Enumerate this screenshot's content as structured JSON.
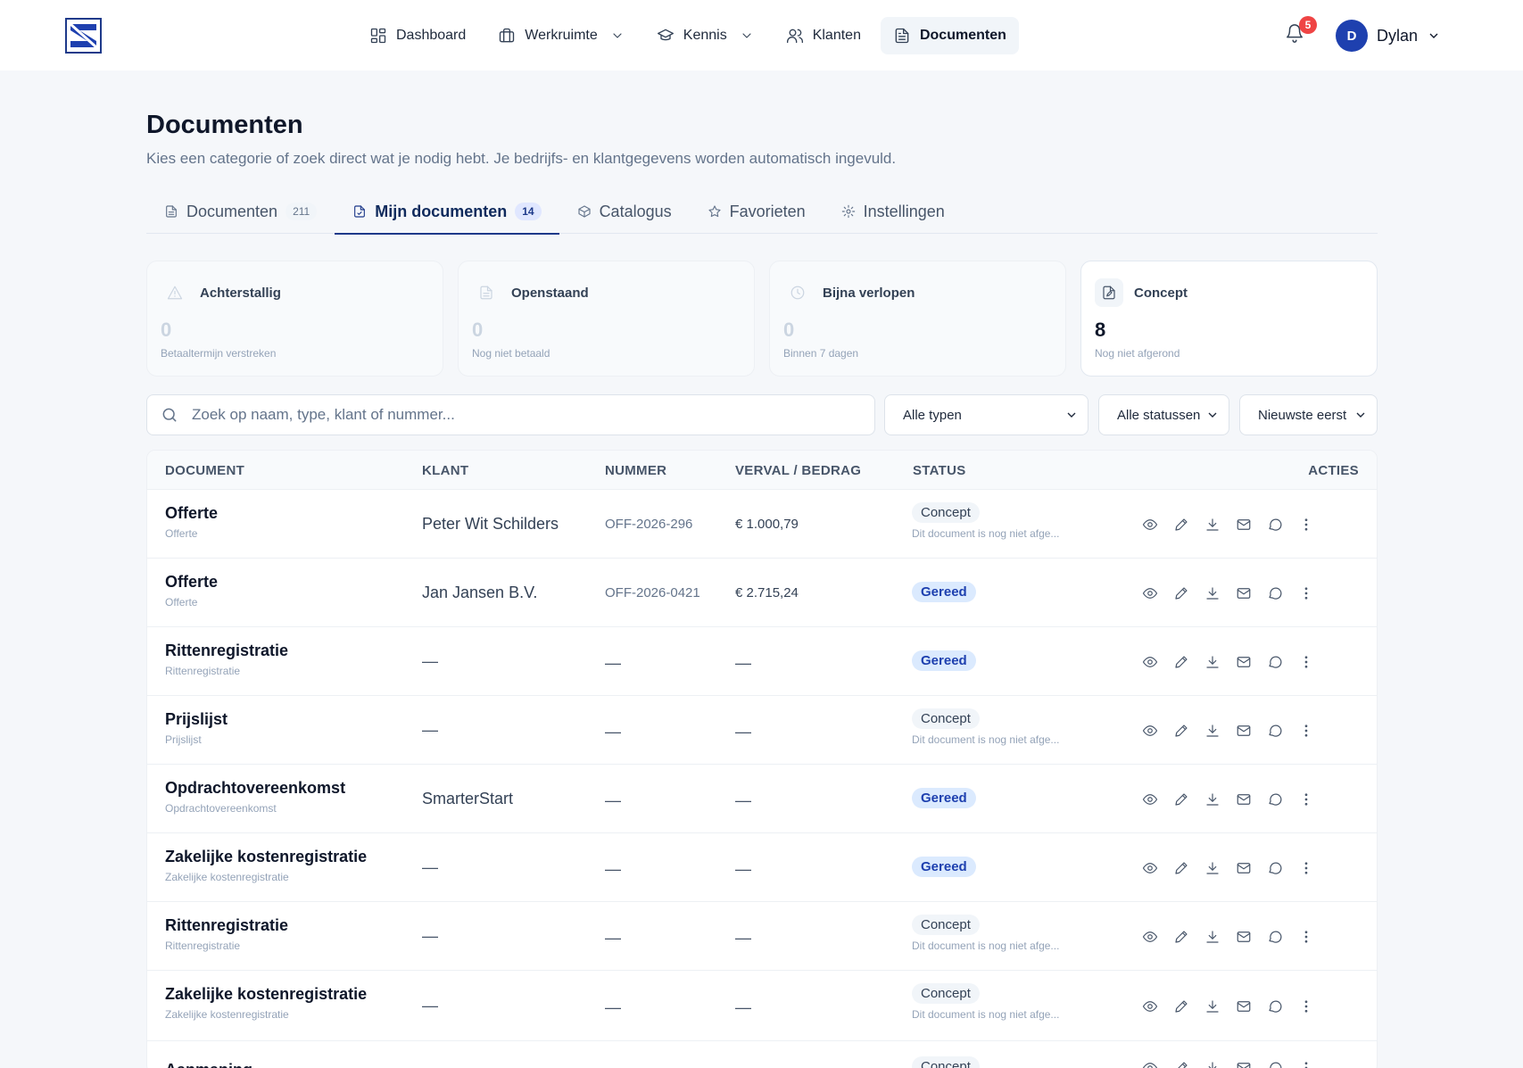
{
  "nav": {
    "items": [
      {
        "label": "Dashboard",
        "icon": "dashboard-icon"
      },
      {
        "label": "Werkruimte",
        "icon": "briefcase-icon",
        "dropdown": true
      },
      {
        "label": "Kennis",
        "icon": "graduation-cap-icon",
        "dropdown": true
      },
      {
        "label": "Klanten",
        "icon": "users-icon"
      },
      {
        "label": "Documenten",
        "icon": "document-icon",
        "active": true
      }
    ],
    "notifications": "5",
    "user_initial": "D",
    "user_name": "Dylan"
  },
  "page": {
    "title": "Documenten",
    "subtitle": "Kies een categorie of zoek direct wat je nodig hebt. Je bedrijfs- en klantgegevens worden automatisch ingevuld."
  },
  "tabs": [
    {
      "label": "Documenten",
      "count": "211"
    },
    {
      "label": "Mijn documenten",
      "count": "14"
    },
    {
      "label": "Catalogus"
    },
    {
      "label": "Favorieten"
    },
    {
      "label": "Instellingen"
    }
  ],
  "stats": [
    {
      "label": "Achterstallig",
      "value": "0",
      "sub": "Betaaltermijn verstreken"
    },
    {
      "label": "Openstaand",
      "value": "0",
      "sub": "Nog niet betaald"
    },
    {
      "label": "Bijna verlopen",
      "value": "0",
      "sub": "Binnen 7 dagen"
    },
    {
      "label": "Concept",
      "value": "8",
      "sub": "Nog niet afgerond"
    }
  ],
  "filters": {
    "search_placeholder": "Zoek op naam, type, klant of nummer...",
    "type": "Alle typen",
    "status": "Alle statussen",
    "sort": "Nieuwste eerst"
  },
  "table": {
    "headers": {
      "document": "DOCUMENT",
      "klant": "KLANT",
      "nummer": "NUMMER",
      "verval": "VERVAL / BEDRAG",
      "status": "STATUS",
      "acties": "ACTIES"
    },
    "rows": [
      {
        "name": "Offerte",
        "type": "Offerte",
        "client": "Peter Wit Schilders",
        "number": "OFF-2026-296",
        "amount": "€ 1.000,79",
        "status": "Concept",
        "note": "Dit document is nog niet afge..."
      },
      {
        "name": "Offerte",
        "type": "Offerte",
        "client": "Jan Jansen B.V.",
        "number": "OFF-2026-0421",
        "amount": "€ 2.715,24",
        "status": "Gereed",
        "note": ""
      },
      {
        "name": "Rittenregistratie",
        "type": "Rittenregistratie",
        "client": "—",
        "number": "—",
        "amount": "—",
        "status": "Gereed",
        "note": ""
      },
      {
        "name": "Prijslijst",
        "type": "Prijslijst",
        "client": "—",
        "number": "—",
        "amount": "—",
        "status": "Concept",
        "note": "Dit document is nog niet afge..."
      },
      {
        "name": "Opdrachtovereenkomst",
        "type": "Opdrachtovereenkomst",
        "client": "SmarterStart",
        "number": "—",
        "amount": "—",
        "status": "Gereed",
        "note": ""
      },
      {
        "name": "Zakelijke kostenregistratie",
        "type": "Zakelijke kostenregistratie",
        "client": "—",
        "number": "—",
        "amount": "—",
        "status": "Gereed",
        "note": ""
      },
      {
        "name": "Rittenregistratie",
        "type": "Rittenregistratie",
        "client": "—",
        "number": "—",
        "amount": "—",
        "status": "Concept",
        "note": "Dit document is nog niet afge..."
      },
      {
        "name": "Zakelijke kostenregistratie",
        "type": "Zakelijke kostenregistratie",
        "client": "—",
        "number": "—",
        "amount": "—",
        "status": "Concept",
        "note": "Dit document is nog niet afge..."
      },
      {
        "name": "Aanmaning",
        "type": "",
        "client": "",
        "number": "",
        "amount": "",
        "status": "Concept",
        "note": ""
      }
    ]
  },
  "colors": {
    "accent": "#1e3a8a",
    "gereed_bg": "#dbeafe",
    "badge": "#ef4444"
  }
}
